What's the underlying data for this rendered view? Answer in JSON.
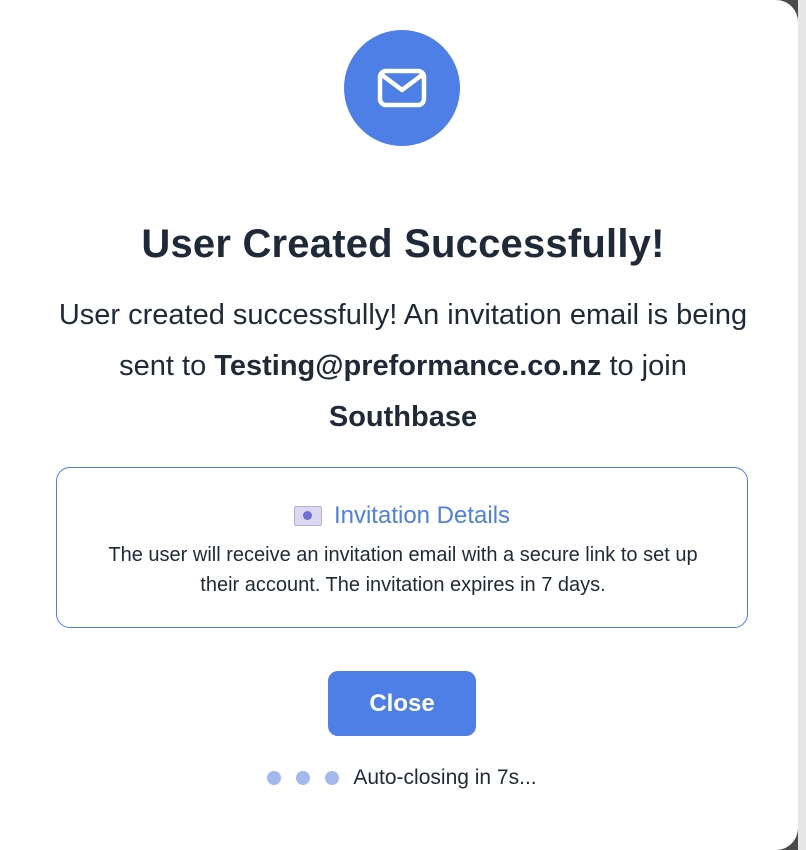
{
  "dialog": {
    "title": "User Created Successfully!",
    "message_prefix": "User created successfully! An invitation email is being sent to",
    "email": "Testing@preformance.co.nz",
    "message_middle": "to join",
    "organization": "Southbase",
    "icon": "mail-icon",
    "accent_color": "#4d7fe6"
  },
  "details": {
    "icon": "envelope-icon",
    "heading": "Invitation Details",
    "text": "The user will receive an invitation email with a secure link to set up their account. The invitation expires in 7 days."
  },
  "actions": {
    "close_label": "Close"
  },
  "autoclose": {
    "text": "Auto-closing in 7s..."
  }
}
